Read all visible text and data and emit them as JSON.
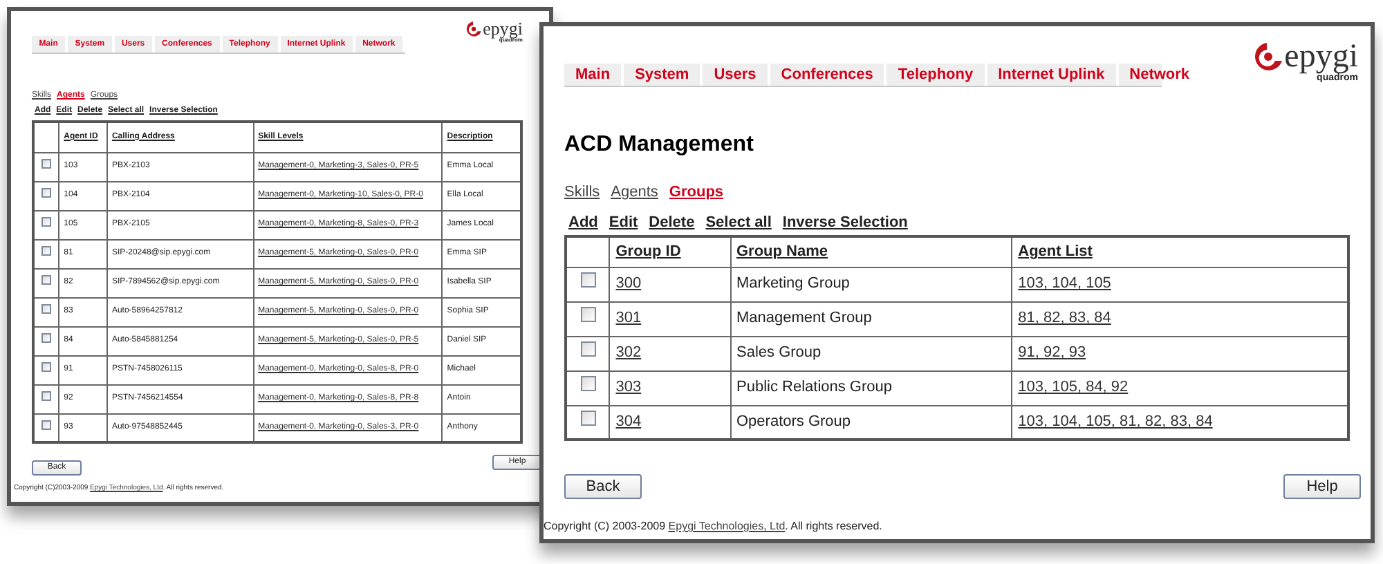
{
  "back_window": {
    "nav": [
      "Main",
      "System",
      "Users",
      "Conferences",
      "Telephony",
      "Internet Uplink",
      "Network"
    ],
    "logo": {
      "name": "epygi",
      "subtitle": "quadrom"
    },
    "tabs": [
      {
        "label": "Skills",
        "selected": false
      },
      {
        "label": "Agents",
        "selected": true
      },
      {
        "label": "Groups",
        "selected": false
      }
    ],
    "actions": [
      "Add",
      "Edit",
      "Delete",
      "Select all",
      "Inverse Selection"
    ],
    "table": {
      "columns": [
        {
          "label": "Agent ID",
          "kind": "text"
        },
        {
          "label": "Calling Address",
          "kind": "text"
        },
        {
          "label": "Skill Levels",
          "kind": "link"
        },
        {
          "label": "Description",
          "kind": "text"
        }
      ],
      "rows": [
        {
          "checked": false,
          "cells": [
            "103",
            "PBX-2103",
            "Management-0, Marketing-3, Sales-0, PR-5",
            "Emma Local"
          ]
        },
        {
          "checked": false,
          "cells": [
            "104",
            "PBX-2104",
            "Management-0, Marketing-10, Sales-0, PR-0",
            "Ella Local"
          ]
        },
        {
          "checked": false,
          "cells": [
            "105",
            "PBX-2105",
            "Management-0, Marketing-8, Sales-0, PR-3",
            "James Local"
          ]
        },
        {
          "checked": false,
          "cells": [
            "81",
            "SIP-20248@sip.epygi.com",
            "Management-5, Marketing-0, Sales-0, PR-0",
            "Emma SIP"
          ]
        },
        {
          "checked": false,
          "cells": [
            "82",
            "SIP-7894562@sip.epygi.com",
            "Management-5, Marketing-0, Sales-0, PR-0",
            "Isabella SIP"
          ]
        },
        {
          "checked": false,
          "cells": [
            "83",
            "Auto-58964257812",
            "Management-5, Marketing-0, Sales-0, PR-0",
            "Sophia SIP"
          ]
        },
        {
          "checked": false,
          "cells": [
            "84",
            "Auto-5845881254",
            "Management-5, Marketing-0, Sales-0, PR-5",
            "Daniel SIP"
          ]
        },
        {
          "checked": false,
          "cells": [
            "91",
            "PSTN-7458026115",
            "Management-0, Marketing-0, Sales-8, PR-0",
            "Michael"
          ]
        },
        {
          "checked": false,
          "cells": [
            "92",
            "PSTN-7456214554",
            "Management-0, Marketing-0, Sales-8, PR-8",
            "Antoin"
          ]
        },
        {
          "checked": false,
          "cells": [
            "93",
            "Auto-97548852445",
            "Management-0, Marketing-0, Sales-3, PR-0",
            "Anthony"
          ]
        }
      ]
    },
    "back_button": "Back",
    "help_button": "Help",
    "copyright": {
      "before": "Copyright (C)2003-2009 ",
      "link": "Epygi Technologies, Ltd",
      "after": ". All rights reserved."
    }
  },
  "front_window": {
    "nav": [
      "Main",
      "System",
      "Users",
      "Conferences",
      "Telephony",
      "Internet Uplink",
      "Network"
    ],
    "logo": {
      "name": "epygi",
      "subtitle": "quadrom"
    },
    "title": "ACD Management",
    "tabs": [
      {
        "label": "Skills",
        "selected": false
      },
      {
        "label": "Agents",
        "selected": false
      },
      {
        "label": "Groups",
        "selected": true
      }
    ],
    "actions": [
      "Add",
      "Edit",
      "Delete",
      "Select all",
      "Inverse Selection"
    ],
    "table": {
      "columns": [
        {
          "label": "Group ID",
          "kind": "link"
        },
        {
          "label": "Group Name",
          "kind": "text"
        },
        {
          "label": "Agent List",
          "kind": "link"
        }
      ],
      "rows": [
        {
          "checked": false,
          "cells": [
            "300",
            "Marketing Group",
            "103, 104, 105"
          ]
        },
        {
          "checked": false,
          "cells": [
            "301",
            "Management Group",
            "81, 82, 83, 84"
          ]
        },
        {
          "checked": false,
          "cells": [
            "302",
            "Sales Group",
            "91, 92, 93"
          ]
        },
        {
          "checked": false,
          "cells": [
            "303",
            "Public Relations Group",
            "103, 105, 84, 92"
          ]
        },
        {
          "checked": false,
          "cells": [
            "304",
            "Operators Group",
            "103, 104, 105, 81, 82, 83, 84"
          ]
        }
      ]
    },
    "back_button": "Back",
    "help_button": "Help",
    "copyright": {
      "before": "Copyright (C) 2003-2009 ",
      "link": "Epygi Technologies, Ltd",
      "after": ". All rights reserved."
    }
  }
}
